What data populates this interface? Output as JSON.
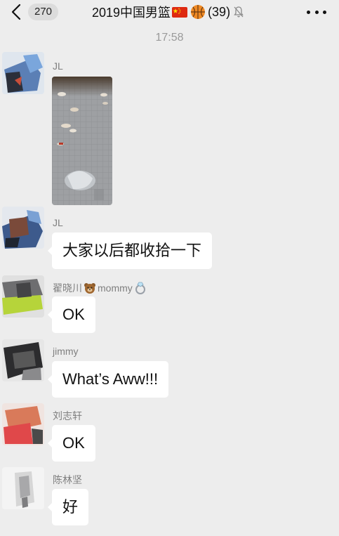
{
  "header": {
    "unread_count": "270",
    "title": "2019中国男篮",
    "member_count": "(39)"
  },
  "timestamp": "17:58",
  "messages": [
    {
      "sender": "JL",
      "type": "image",
      "image_desc": "floor with scattered trash"
    },
    {
      "sender": "JL",
      "text": "大家以后都收拾一下"
    },
    {
      "sender": "翟晓川",
      "sender_suffix": "mommy",
      "text": "OK"
    },
    {
      "sender": "jimmy",
      "text": "What’s Aww!!!"
    },
    {
      "sender": "刘志轩",
      "text": "OK"
    },
    {
      "sender": "陈林坚",
      "text": "好"
    }
  ],
  "colors": {
    "background": "#ededed",
    "bubble": "#ffffff",
    "sender_text": "#7f7f7f",
    "timestamp_text": "#9a9a9a"
  }
}
